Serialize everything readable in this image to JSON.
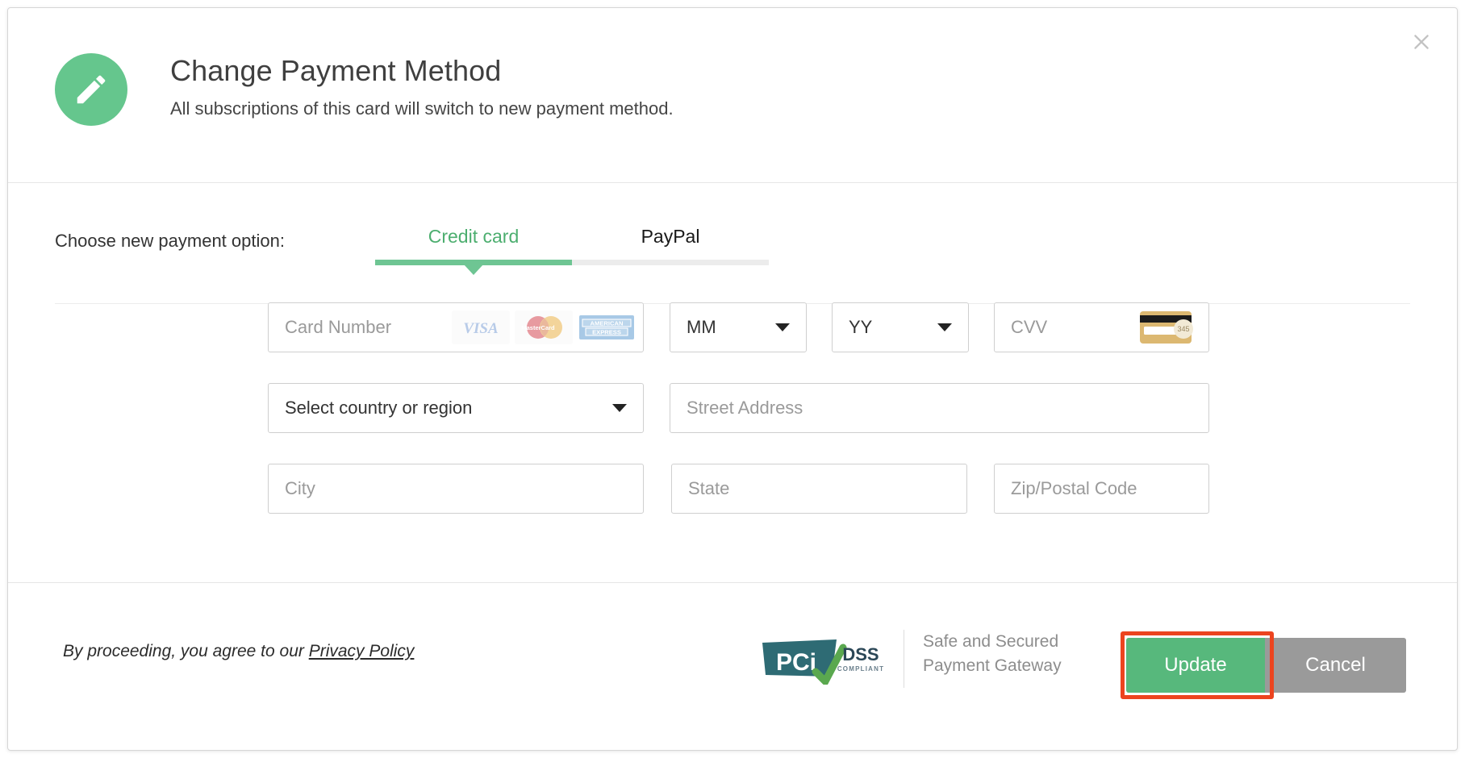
{
  "dialog": {
    "title": "Change Payment Method",
    "subtitle": "All subscriptions of this card will switch to new payment method.",
    "close_icon": "close-icon",
    "header_icon": "pencil-icon",
    "accent_green": "#65c68d",
    "highlight_color": "#ec441f"
  },
  "payment_option": {
    "label": "Choose new payment option:",
    "tabs": [
      {
        "label": "Credit card",
        "active": true
      },
      {
        "label": "PayPal",
        "active": false
      }
    ]
  },
  "form": {
    "card_number": {
      "placeholder": "Card Number"
    },
    "card_brands": [
      "VISA",
      "MasterCard",
      "AMERICAN EXPRESS"
    ],
    "expiry_month": {
      "value": "MM"
    },
    "expiry_year": {
      "value": "YY"
    },
    "cvv": {
      "placeholder": "CVV",
      "card_hint_digits": "345"
    },
    "country": {
      "value": "Select country or region"
    },
    "street": {
      "placeholder": "Street Address"
    },
    "city": {
      "placeholder": "City"
    },
    "state": {
      "placeholder": "State"
    },
    "zip": {
      "placeholder": "Zip/Postal Code"
    }
  },
  "footer": {
    "legal_prefix": "By proceeding, you agree to our ",
    "legal_link": "Privacy Policy",
    "badge": {
      "pci": "PCI",
      "dss": "DSS",
      "compliant": "COMPLIANT"
    },
    "secure_line1": "Safe and Secured",
    "secure_line2": "Payment Gateway",
    "update_label": "Update",
    "cancel_label": "Cancel"
  }
}
